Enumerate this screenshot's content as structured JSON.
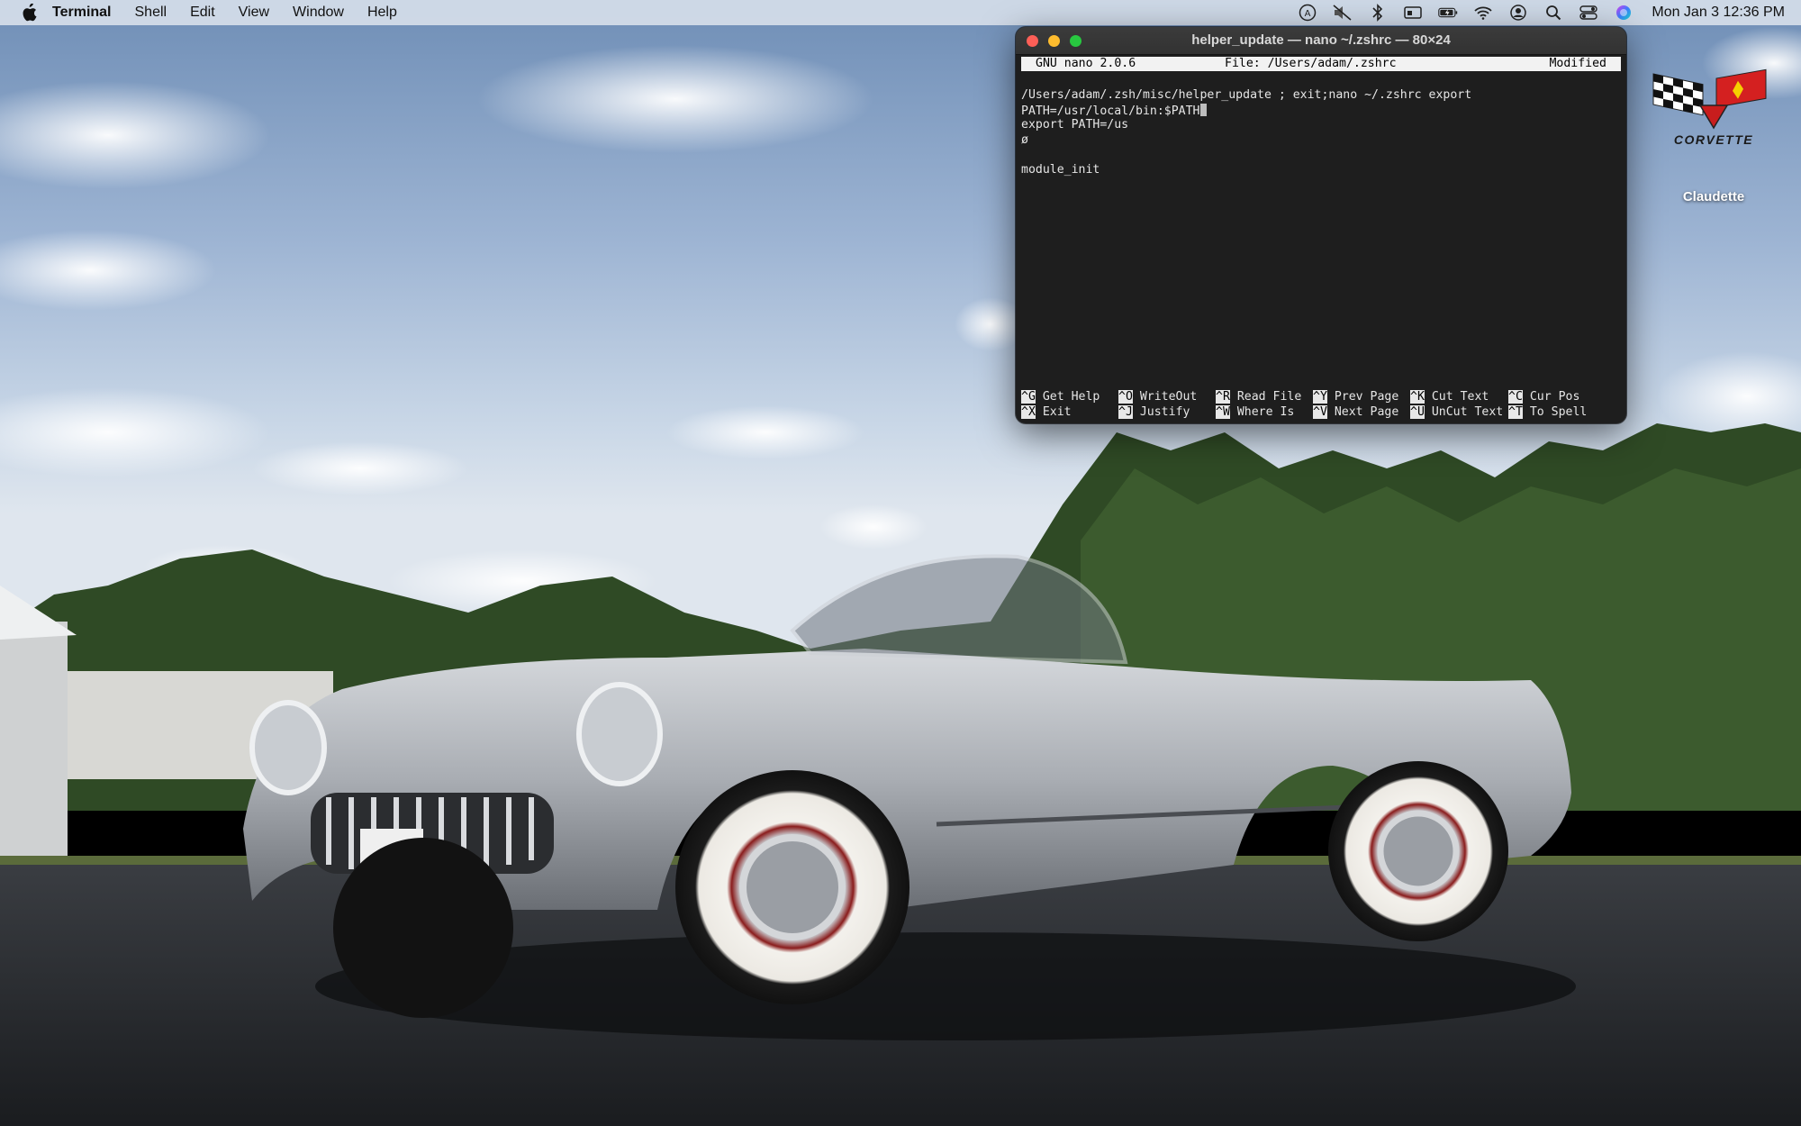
{
  "menubar": {
    "app_name": "Terminal",
    "menus": [
      "Shell",
      "Edit",
      "View",
      "Window",
      "Help"
    ],
    "clock": "Mon Jan 3  12:36 PM"
  },
  "terminal": {
    "title": "helper_update — nano ~/.zshrc — 80×24",
    "nano_version": "GNU nano 2.0.6",
    "file_label": "File: /Users/adam/.zshrc",
    "status": "Modified",
    "lines": [
      "/Users/adam/.zsh/misc/helper_update ; exit;nano ~/.zshrc export",
      "PATH=/usr/local/bin:$PATH",
      "export PATH=/us",
      "ø",
      "",
      "module_init"
    ],
    "shortcuts_row1": [
      {
        "key": "^G",
        "label": "Get Help"
      },
      {
        "key": "^O",
        "label": "WriteOut"
      },
      {
        "key": "^R",
        "label": "Read File"
      },
      {
        "key": "^Y",
        "label": "Prev Page"
      },
      {
        "key": "^K",
        "label": "Cut Text"
      },
      {
        "key": "^C",
        "label": "Cur Pos"
      }
    ],
    "shortcuts_row2": [
      {
        "key": "^X",
        "label": "Exit"
      },
      {
        "key": "^J",
        "label": "Justify"
      },
      {
        "key": "^W",
        "label": "Where Is"
      },
      {
        "key": "^V",
        "label": "Next Page"
      },
      {
        "key": "^U",
        "label": "UnCut Text"
      },
      {
        "key": "^T",
        "label": "To Spell"
      }
    ]
  },
  "desktop": {
    "icon_label": "Claudette",
    "logo_text": "CORVETTE"
  },
  "colors": {
    "accent_red": "#fe5f57",
    "accent_yellow": "#febc2e",
    "accent_green": "#28c840"
  }
}
